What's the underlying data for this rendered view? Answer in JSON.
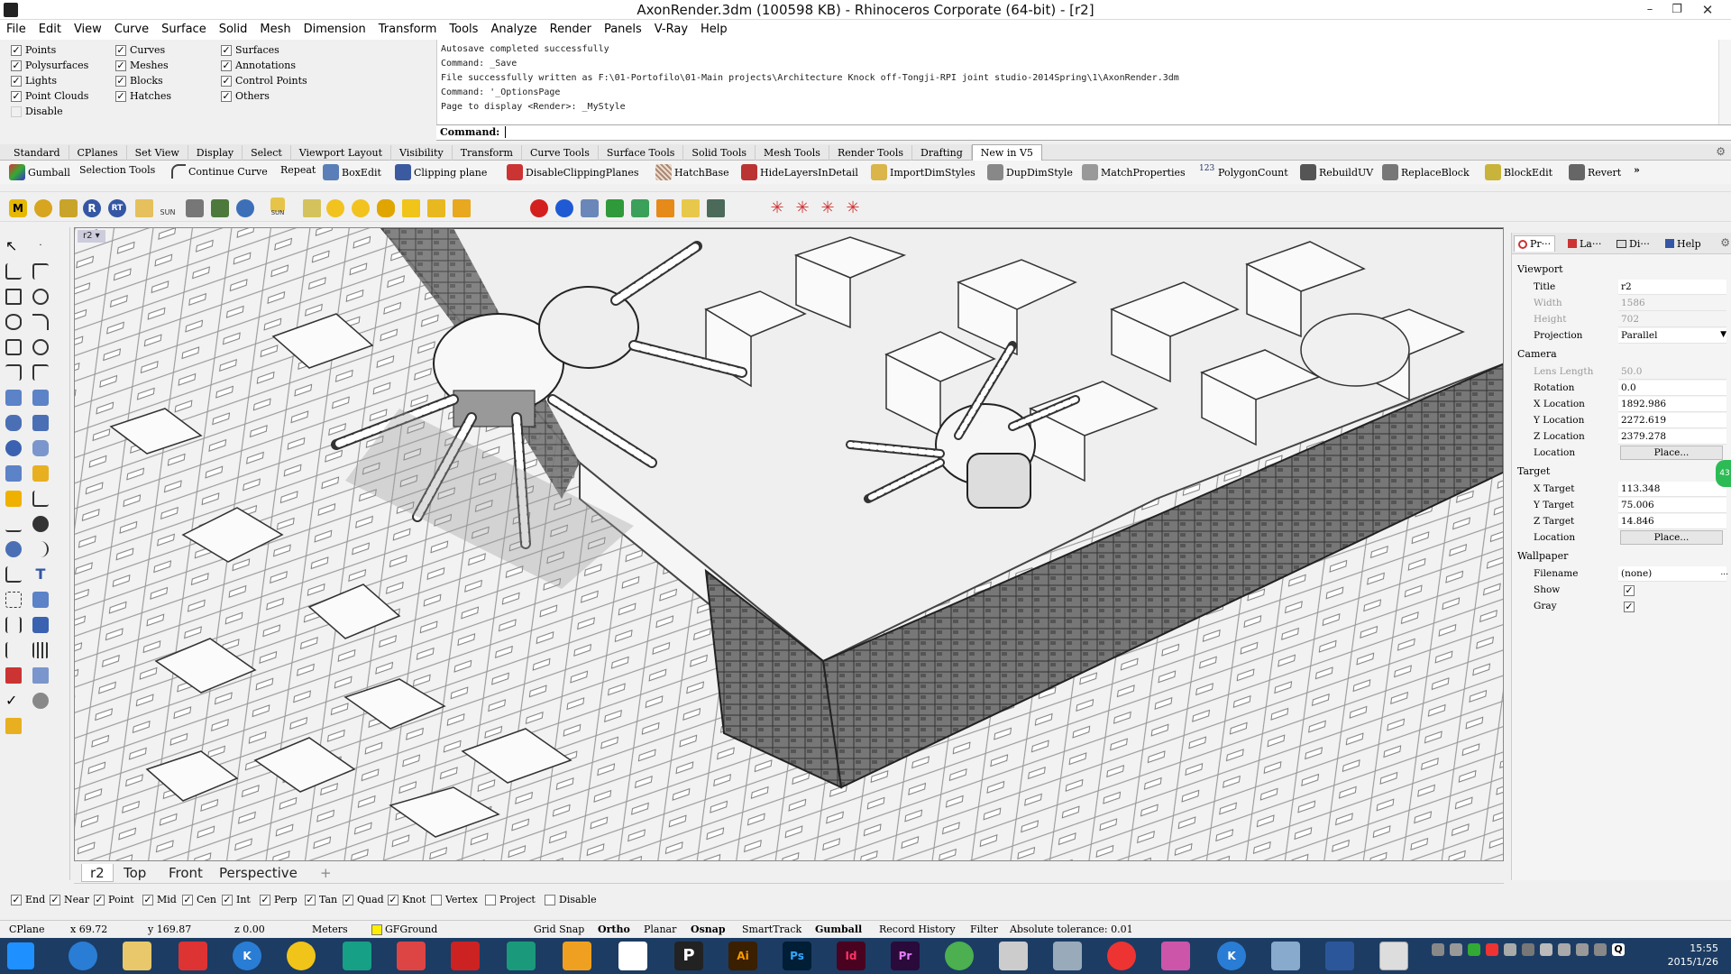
{
  "window": {
    "title": "AxonRender.3dm (100598 KB) - Rhinoceros Corporate (64-bit) - [r2]"
  },
  "menu": [
    "File",
    "Edit",
    "View",
    "Curve",
    "Surface",
    "Solid",
    "Mesh",
    "Dimension",
    "Transform",
    "Tools",
    "Analyze",
    "Render",
    "Panels",
    "V-Ray",
    "Help"
  ],
  "filters": [
    {
      "label": "Points",
      "checked": true
    },
    {
      "label": "Polysurfaces",
      "checked": true
    },
    {
      "label": "Lights",
      "checked": true
    },
    {
      "label": "Point Clouds",
      "checked": true
    },
    {
      "label": "Disable",
      "checked": false
    },
    {
      "label": "Curves",
      "checked": true
    },
    {
      "label": "Meshes",
      "checked": true
    },
    {
      "label": "Blocks",
      "checked": true
    },
    {
      "label": "Hatches",
      "checked": true
    },
    {
      "label": "Surfaces",
      "checked": true
    },
    {
      "label": "Annotations",
      "checked": true
    },
    {
      "label": "Control Points",
      "checked": true
    },
    {
      "label": "Others",
      "checked": true
    }
  ],
  "command_history": [
    "Autosave completed successfully",
    "Command: _Save",
    "File successfully written as F:\\01-Portofilo\\01-Main projects\\Architecture Knock off-Tongji-RPI joint studio-2014Spring\\1\\AxonRender.3dm",
    "Command: '_OptionsPage",
    "Page to display <Render>: _MyStyle"
  ],
  "command_prompt": "Command:",
  "toolbar_tabs": [
    "Standard",
    "CPlanes",
    "Set View",
    "Display",
    "Select",
    "Viewport Layout",
    "Visibility",
    "Transform",
    "Curve Tools",
    "Surface Tools",
    "Solid Tools",
    "Mesh Tools",
    "Render Tools",
    "Drafting",
    "New in V5"
  ],
  "active_toolbar_tab": "New in V5",
  "toolbar_buttons": [
    "Gumball",
    "Selection Tools",
    "Continue Curve",
    "Repeat",
    "BoxEdit",
    "Clipping plane",
    "DisableClippingPlanes",
    "HatchBase",
    "HideLayersInDetail",
    "ImportDimStyles",
    "DupDimStyle",
    "MatchProperties",
    "PolygonCount",
    "RebuildUV",
    "ReplaceBlock",
    "BlockEdit",
    "Revert"
  ],
  "toolbar_overflow": "»",
  "polygoncount_badge": "123",
  "render_toolbar_texts": {
    "m": "M",
    "r": "R",
    "rt": "RT",
    "sun": "SUN",
    "sun2": "SUN"
  },
  "viewport": {
    "name": "r2",
    "arrow": "▾"
  },
  "viewport_tabs": [
    "r2",
    "Top",
    "Front",
    "Perspective"
  ],
  "viewport_add": "+",
  "panel_tabs": [
    "Pr···",
    "La···",
    "Di···",
    "Help"
  ],
  "properties": {
    "viewport_header": "Viewport",
    "title_label": "Title",
    "title_value": "r2",
    "width_label": "Width",
    "width_value": "1586",
    "height_label": "Height",
    "height_value": "702",
    "projection_label": "Projection",
    "projection_value": "Parallel",
    "camera_header": "Camera",
    "lens_label": "Lens Length",
    "lens_value": "50.0",
    "rotation_label": "Rotation",
    "rotation_value": "0.0",
    "xloc_label": "X Location",
    "xloc_value": "1892.986",
    "yloc_label": "Y Location",
    "yloc_value": "2272.619",
    "zloc_label": "Z Location",
    "zloc_value": "2379.278",
    "camloc_label": "Location",
    "camloc_button": "Place...",
    "target_header": "Target",
    "xt_label": "X Target",
    "xt_value": "113.348",
    "yt_label": "Y Target",
    "yt_value": "75.006",
    "zt_label": "Z Target",
    "zt_value": "14.846",
    "tloc_label": "Location",
    "tloc_button": "Place...",
    "wallpaper_header": "Wallpaper",
    "filename_label": "Filename",
    "filename_value": "(none)",
    "show_label": "Show",
    "show_checked": true,
    "gray_label": "Gray",
    "gray_checked": true,
    "side_badge": "43"
  },
  "osnaps": [
    {
      "label": "End",
      "checked": true
    },
    {
      "label": "Near",
      "checked": true
    },
    {
      "label": "Point",
      "checked": true
    },
    {
      "label": "Mid",
      "checked": true
    },
    {
      "label": "Cen",
      "checked": true
    },
    {
      "label": "Int",
      "checked": true
    },
    {
      "label": "Perp",
      "checked": true
    },
    {
      "label": "Tan",
      "checked": true
    },
    {
      "label": "Quad",
      "checked": true
    },
    {
      "label": "Knot",
      "checked": true
    },
    {
      "label": "Vertex",
      "checked": false
    },
    {
      "label": "Project",
      "checked": false
    },
    {
      "label": "Disable",
      "checked": false
    }
  ],
  "status": {
    "cplane": "CPlane",
    "x": "x 69.72",
    "y": "y 169.87",
    "z": "z 0.00",
    "units": "Meters",
    "layer": "GFGround",
    "grid_snap": "Grid Snap",
    "ortho": "Ortho",
    "planar": "Planar",
    "osnap": "Osnap",
    "smarttrack": "SmartTrack",
    "gumball": "Gumball",
    "record_history": "Record History",
    "filter": "Filter",
    "tolerance": "Absolute tolerance: 0.01"
  },
  "taskbar_letters": {
    "k1": "K",
    "p": "P",
    "ai": "Ai",
    "ps": "Ps",
    "id": "Id",
    "pr": "Pr",
    "k2": "K",
    "q": "Q"
  },
  "clock": {
    "time": "15:55",
    "date": "2015/1/26"
  },
  "colors": {
    "accent": "#1c3c63",
    "viewport_bg": "#e6e6e6",
    "layer_swatch": "#ffee00"
  }
}
